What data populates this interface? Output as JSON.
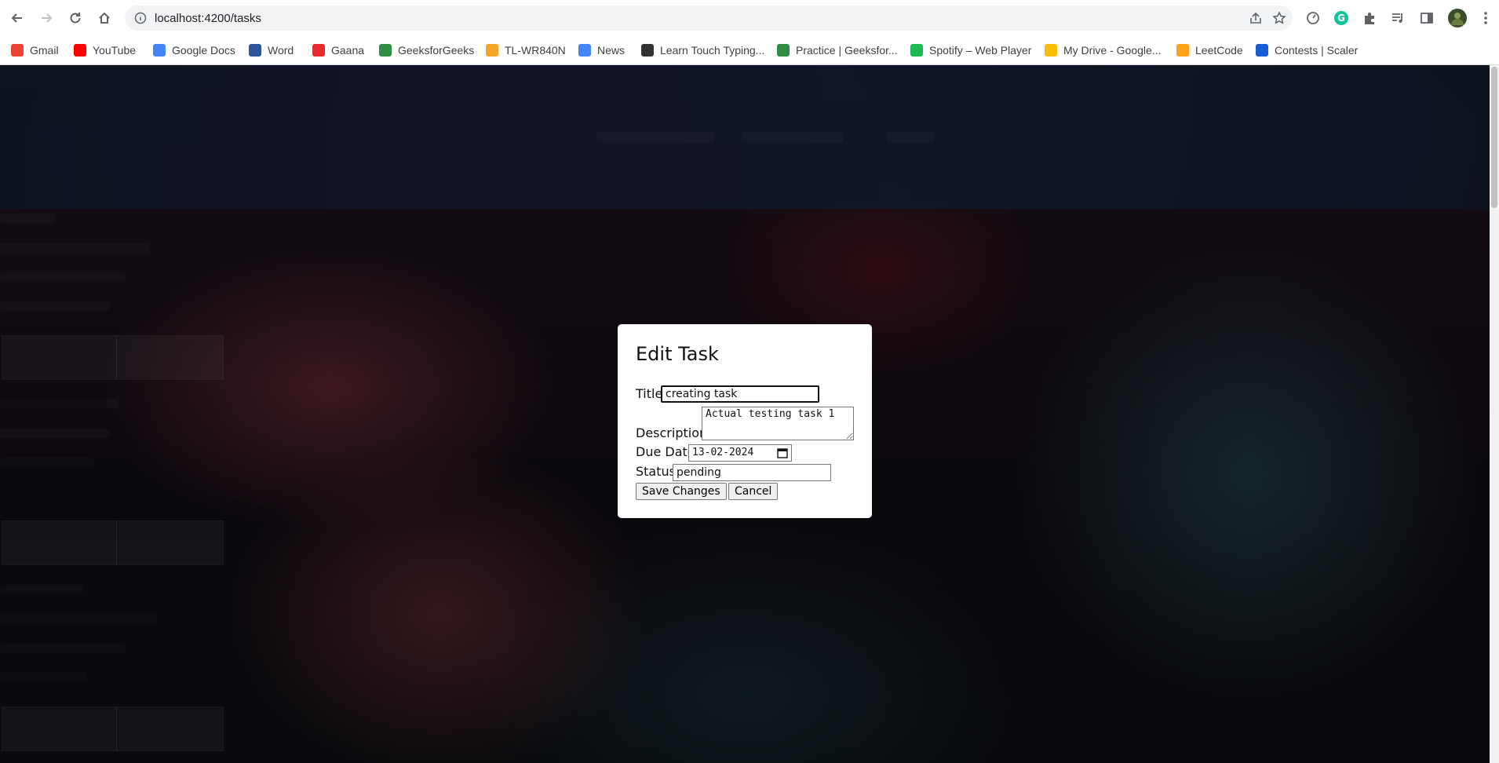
{
  "browser": {
    "url": "localhost:4200/tasks",
    "bookmarks": [
      {
        "label": "Gmail",
        "icon": "gmail-icon",
        "color": "#ea4335"
      },
      {
        "label": "YouTube",
        "icon": "youtube-icon",
        "color": "#ff0000"
      },
      {
        "label": "Google Docs",
        "icon": "google-docs-icon",
        "color": "#4285f4"
      },
      {
        "label": "Word",
        "icon": "word-icon",
        "color": "#2b579a"
      },
      {
        "label": "Gaana",
        "icon": "gaana-icon",
        "color": "#e72c30"
      },
      {
        "label": "GeeksforGeeks",
        "icon": "geeksforgeeks-icon",
        "color": "#2f8d46"
      },
      {
        "label": "TL-WR840N",
        "icon": "tplink-icon",
        "color": "#f5a623"
      },
      {
        "label": "News",
        "icon": "google-news-icon",
        "color": "#4285f4"
      },
      {
        "label": "Learn Touch Typing...",
        "icon": "typing-icon",
        "color": "#333333"
      },
      {
        "label": "Practice | Geeksfor...",
        "icon": "geeksforgeeks-icon",
        "color": "#2f8d46"
      },
      {
        "label": "Spotify – Web Player",
        "icon": "spotify-icon",
        "color": "#1db954"
      },
      {
        "label": "My Drive - Google...",
        "icon": "google-drive-icon",
        "color": "#fbbc04"
      },
      {
        "label": "LeetCode",
        "icon": "leetcode-icon",
        "color": "#ffa116"
      },
      {
        "label": "Contests | Scaler",
        "icon": "scaler-icon",
        "color": "#1a5dd8"
      }
    ]
  },
  "modal": {
    "title": "Edit Task",
    "title_label": "Title",
    "title_value": "creating task",
    "description_label": "Description",
    "description_value": "Actual testing task 1",
    "due_date_label": "Due Date",
    "due_date_value": "13-02-2024",
    "status_label": "Status",
    "status_value": "pending",
    "save_label": "Save Changes",
    "cancel_label": "Cancel"
  }
}
